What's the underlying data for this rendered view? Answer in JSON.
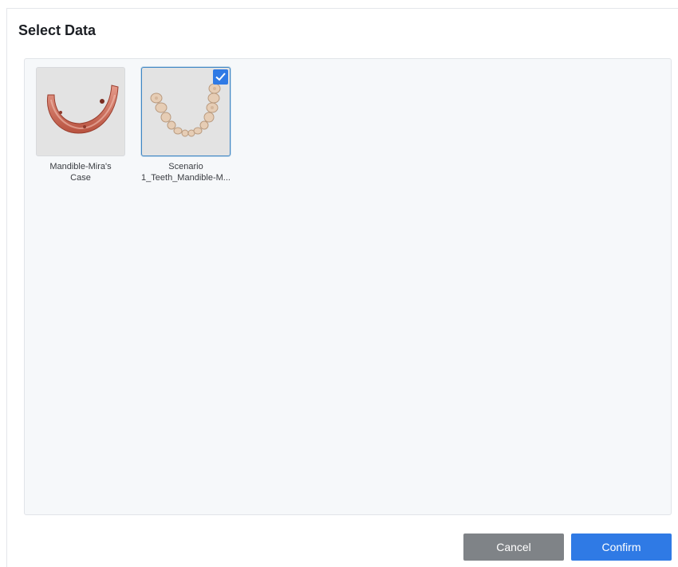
{
  "dialog": {
    "title": "Select Data"
  },
  "items": [
    {
      "caption_line1": "Mandible-Mira's",
      "caption_line2": "Case",
      "selected": false,
      "thumbnail": "mandible-scan-icon"
    },
    {
      "caption_line1": "Scenario",
      "caption_line2": "1_Teeth_Mandible-M...",
      "selected": true,
      "thumbnail": "teeth-scan-icon"
    }
  ],
  "buttons": {
    "cancel_label": "Cancel",
    "confirm_label": "Confirm"
  },
  "colors": {
    "accent": "#2f7ae5",
    "cancel": "#7f8387",
    "panel_bg": "#f6f8fa",
    "selected_border": "#3f86c4"
  }
}
